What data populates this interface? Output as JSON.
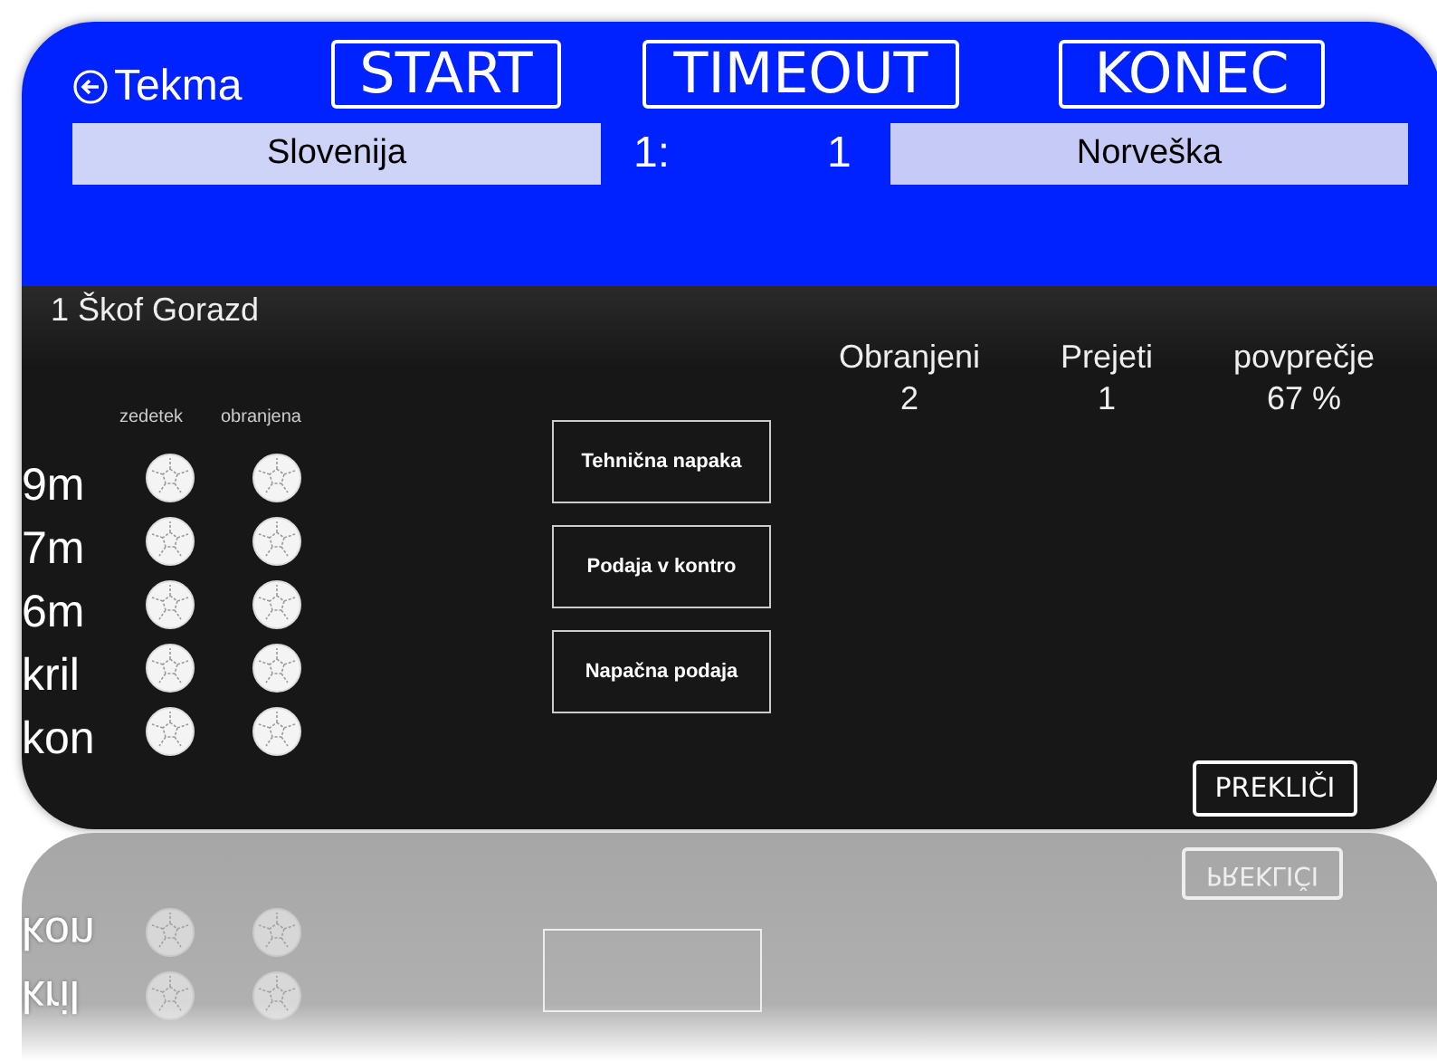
{
  "header": {
    "back_label": "Tekma",
    "buttons": [
      "START",
      "TIMEOUT",
      "KONEC"
    ],
    "home_team": "Slovenija",
    "home_score": "1:",
    "away_score": "1",
    "away_team": "Norveška"
  },
  "player": "1 Škof Gorazd",
  "shots": {
    "columns": [
      "zedetek",
      "obranjena"
    ],
    "rows": [
      {
        "label": "9m"
      },
      {
        "label": "7m"
      },
      {
        "label": "6m"
      },
      {
        "label": "kril"
      },
      {
        "label": "kon"
      }
    ]
  },
  "actions": [
    "Tehnična napaka",
    "Podaja v kontro",
    "Napačna podaja"
  ],
  "stats": [
    {
      "label": "Obranjeni",
      "value": "2"
    },
    {
      "label": "Prejeti",
      "value": "1"
    },
    {
      "label": "povprečje",
      "value": "67 %"
    }
  ],
  "cancel": "PREKLIČI",
  "reflection": {
    "cancel": "PREKLIČI",
    "rows": [
      "kon",
      "kril"
    ]
  }
}
